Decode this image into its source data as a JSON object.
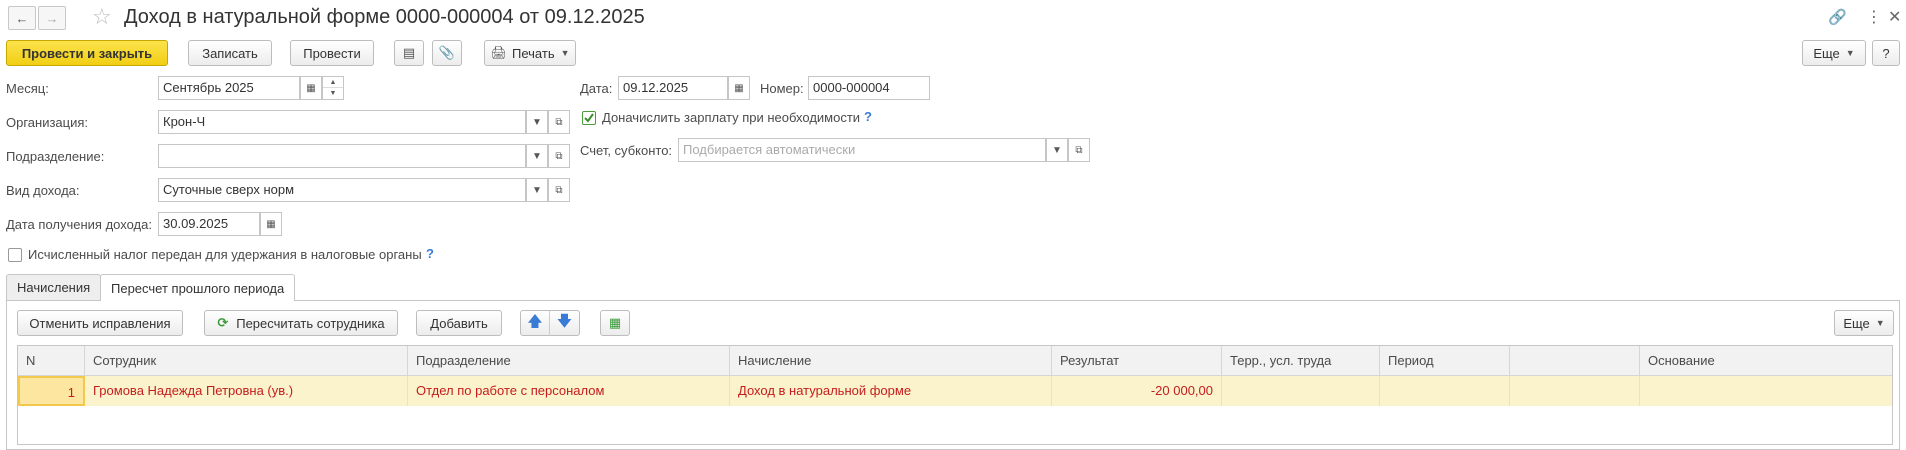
{
  "title": "Доход в натуральной форме 0000-000004 от 09.12.2025",
  "toolbar": {
    "post_close": "Провести и закрыть",
    "save": "Записать",
    "post": "Провести",
    "print": "Печать",
    "more": "Еще",
    "help": "?"
  },
  "fields": {
    "month_label": "Месяц:",
    "month_value": "Сентябрь 2025",
    "org_label": "Организация:",
    "org_value": "Крон-Ч",
    "dept_label": "Подразделение:",
    "dept_value": "",
    "income_type_label": "Вид дохода:",
    "income_type_value": "Суточные сверх норм",
    "income_date_label": "Дата получения дохода:",
    "income_date_value": "30.09.2025",
    "tax_passed_label": "Исчисленный налог передан для удержания в налоговые органы",
    "tax_passed_checked": false,
    "date_label": "Дата:",
    "date_value": "09.12.2025",
    "number_label": "Номер:",
    "number_value": "0000-000004",
    "accrue_label": "Доначислить зарплату при необходимости",
    "accrue_checked": true,
    "account_label": "Счет, субконто:",
    "account_placeholder": "Подбирается автоматически"
  },
  "tabs": [
    {
      "label": "Начисления",
      "active": false
    },
    {
      "label": "Пересчет прошлого периода",
      "active": true
    }
  ],
  "table_toolbar": {
    "cancel_fixes": "Отменить исправления",
    "recalc_employee": "Пересчитать сотрудника",
    "add": "Добавить",
    "more": "Еще"
  },
  "table": {
    "columns": [
      "N",
      "Сотрудник",
      "Подразделение",
      "Начисление",
      "Результат",
      "Терр., усл. труда",
      "Период",
      "",
      "Основание"
    ],
    "rows": [
      {
        "n": "1",
        "employee": "Громова Надежда Петровна (ув.)",
        "department": "Отдел по работе с персоналом",
        "accrual": "Доход в натуральной форме",
        "result": "-20 000,00",
        "territory": "",
        "period": "",
        "extra": "",
        "basis": ""
      }
    ]
  },
  "colors": {
    "primary_button": "#f2cf14",
    "row_highlight": "#fbf3cc",
    "row_text": "#c41d1d",
    "help_blue": "#3a7bd5",
    "arrow_blue": "#3a7bd5"
  }
}
